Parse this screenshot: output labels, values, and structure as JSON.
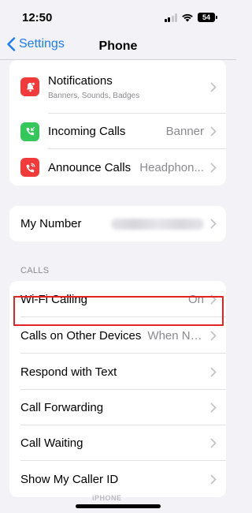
{
  "status_bar": {
    "time": "12:50",
    "battery": "54"
  },
  "nav": {
    "back_label": "Settings",
    "title": "Phone"
  },
  "group1": [
    {
      "label": "Notifications",
      "subtitle": "Banners, Sounds, Badges",
      "icon": "bell-icon",
      "icon_color": "#f23a3a"
    },
    {
      "label": "Incoming Calls",
      "value": "Banner",
      "icon": "incoming-call-icon",
      "icon_color": "#34c759"
    },
    {
      "label": "Announce Calls",
      "value": "Headphon...",
      "icon": "announce-call-icon",
      "icon_color": "#f23a3a"
    }
  ],
  "my_number": {
    "label": "My Number"
  },
  "calls_section": {
    "header": "CALLS",
    "rows": [
      {
        "label": "Wi-Fi Calling",
        "value": "On"
      },
      {
        "label": "Calls on Other Devices",
        "value": "When Ne..."
      },
      {
        "label": "Respond with Text"
      },
      {
        "label": "Call Forwarding"
      },
      {
        "label": "Call Waiting"
      },
      {
        "label": "Show My Caller ID"
      }
    ]
  },
  "watermark": "iPHONE",
  "colors": {
    "accent": "#1a7cf7",
    "highlight": "#e02424",
    "background": "#f2f2f7"
  }
}
